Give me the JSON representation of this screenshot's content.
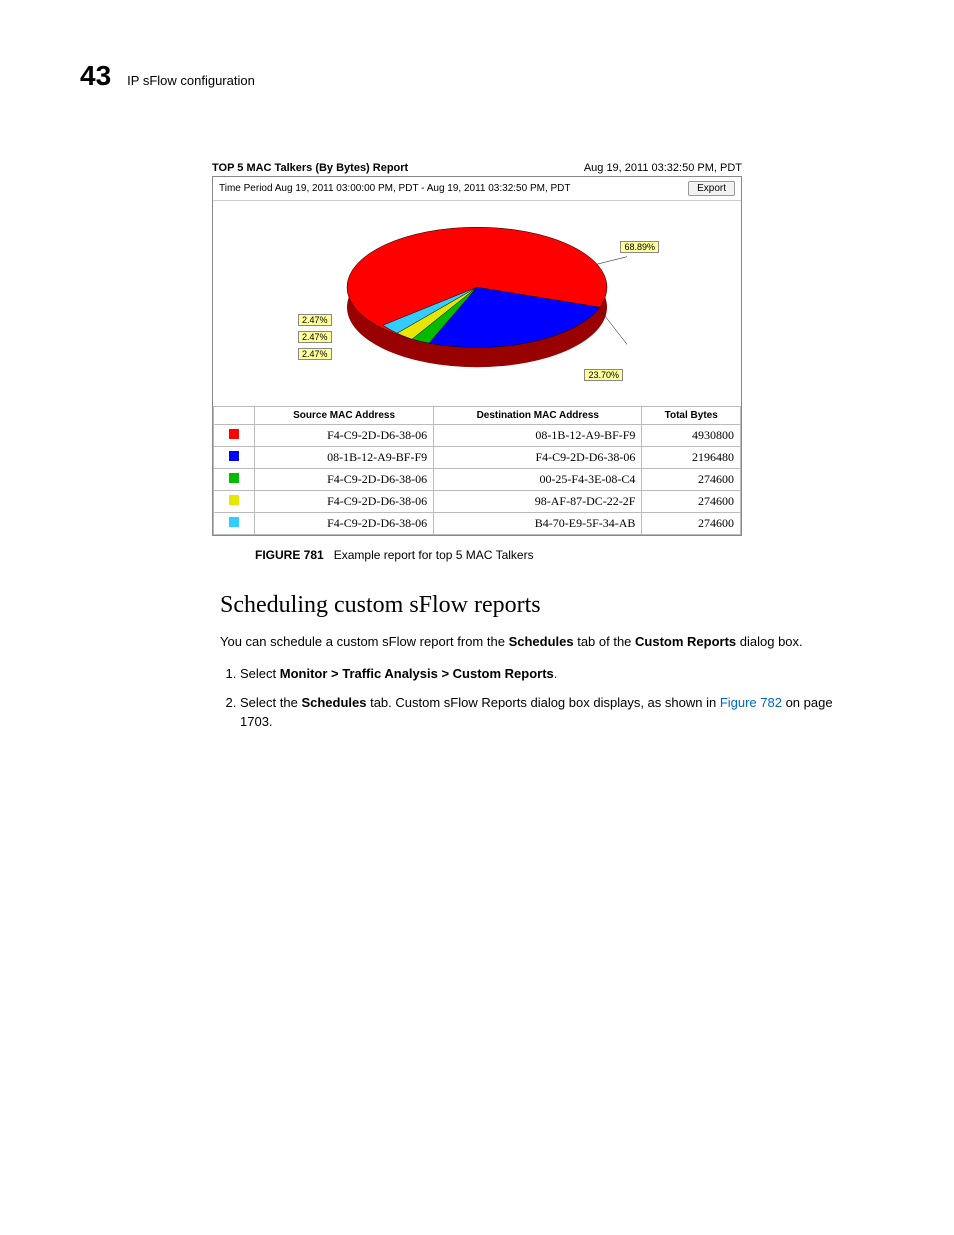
{
  "header": {
    "chapter_number": "43",
    "chapter_title": "IP sFlow configuration"
  },
  "report": {
    "title": "TOP 5 MAC Talkers (By Bytes) Report",
    "timestamp": "Aug 19, 2011 03:32:50 PM, PDT",
    "time_period": "Time Period Aug 19, 2011 03:00:00 PM, PDT - Aug 19, 2011 03:32:50 PM, PDT",
    "export_label": "Export",
    "labels": {
      "big": "68.89%",
      "slice2": "23.70%",
      "s1": "2.47%",
      "s2": "2.47%",
      "s3": "2.47%"
    },
    "columns": {
      "c0": "",
      "c1": "Source MAC Address",
      "c2": "Destination MAC Address",
      "c3": "Total Bytes"
    },
    "rows": [
      {
        "color": "#ff0000",
        "src": "F4-C9-2D-D6-38-06",
        "dst": "08-1B-12-A9-BF-F9",
        "bytes": "4930800"
      },
      {
        "color": "#0000ff",
        "src": "08-1B-12-A9-BF-F9",
        "dst": "F4-C9-2D-D6-38-06",
        "bytes": "2196480"
      },
      {
        "color": "#00bb00",
        "src": "F4-C9-2D-D6-38-06",
        "dst": "00-25-F4-3E-08-C4",
        "bytes": "274600"
      },
      {
        "color": "#e6e600",
        "src": "F4-C9-2D-D6-38-06",
        "dst": "98-AF-87-DC-22-2F",
        "bytes": "274600"
      },
      {
        "color": "#33ccff",
        "src": "F4-C9-2D-D6-38-06",
        "dst": "B4-70-E9-5F-34-AB",
        "bytes": "274600"
      }
    ]
  },
  "chart_data": {
    "type": "pie",
    "title": "TOP 5 MAC Talkers (By Bytes) Report",
    "series": [
      {
        "name": "F4-C9-2D-D6-38-06 → 08-1B-12-A9-BF-F9",
        "pct": 68.89,
        "bytes": 4930800,
        "color": "#ff0000"
      },
      {
        "name": "08-1B-12-A9-BF-F9 → F4-C9-2D-D6-38-06",
        "pct": 23.7,
        "bytes": 2196480,
        "color": "#0000ff"
      },
      {
        "name": "F4-C9-2D-D6-38-06 → 00-25-F4-3E-08-C4",
        "pct": 2.47,
        "bytes": 274600,
        "color": "#00bb00"
      },
      {
        "name": "F4-C9-2D-D6-38-06 → 98-AF-87-DC-22-2F",
        "pct": 2.47,
        "bytes": 274600,
        "color": "#e6e600"
      },
      {
        "name": "F4-C9-2D-D6-38-06 → B4-70-E9-5F-34-AB",
        "pct": 2.47,
        "bytes": 274600,
        "color": "#33ccff"
      }
    ]
  },
  "figure": {
    "num": "FIGURE 781",
    "caption": "Example report for top 5 MAC Talkers"
  },
  "section": {
    "heading": "Scheduling custom sFlow reports",
    "intro_pre": "You can schedule a custom sFlow report from the ",
    "intro_b1": "Schedules",
    "intro_mid": " tab of the ",
    "intro_b2": "Custom Reports",
    "intro_post": " dialog box.",
    "step1_pre": "Select ",
    "step1_b": "Monitor > Traffic Analysis > Custom Reports",
    "step1_post": ".",
    "step2_pre": "Select the ",
    "step2_b": "Schedules",
    "step2_mid": " tab. Custom sFlow Reports dialog box displays, as shown in ",
    "step2_link": "Figure 782",
    "step2_post": " on page 1703."
  }
}
